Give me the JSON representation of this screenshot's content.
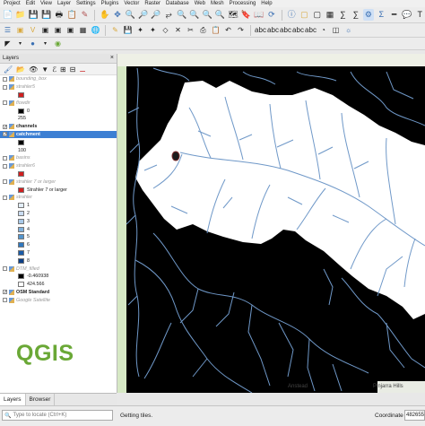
{
  "menu": [
    "Project",
    "Edit",
    "View",
    "Layer",
    "Settings",
    "Plugins",
    "Vector",
    "Raster",
    "Database",
    "Web",
    "Mesh",
    "Processing",
    "Help"
  ],
  "layers_panel": {
    "title": "Layers",
    "close": "×",
    "items": [
      {
        "label": "bounding_box",
        "checked": false,
        "faded": true,
        "bold": false
      },
      {
        "label": "strahler5",
        "checked": false,
        "faded": true,
        "bold": false
      },
      {
        "label": "",
        "swatch": "#d11f1f"
      },
      {
        "label": "flowdir",
        "checked": false,
        "faded": true,
        "bold": false
      },
      {
        "label": "0",
        "swatch": "#000000"
      },
      {
        "label": "255"
      },
      {
        "label": "channels",
        "checked": true,
        "faded": false,
        "bold": true
      },
      {
        "label": "catchment",
        "checked": true,
        "faded": false,
        "bold": true,
        "selected": true
      },
      {
        "label": "",
        "swatch": "#000000"
      },
      {
        "label": "100"
      },
      {
        "label": "basins",
        "checked": false,
        "faded": true,
        "bold": false
      },
      {
        "label": "strahler6",
        "checked": false,
        "faded": true,
        "bold": false
      },
      {
        "label": "",
        "swatch": "#d11f1f"
      },
      {
        "label": "strahler 7 or larger",
        "checked": false,
        "faded": true,
        "bold": false
      },
      {
        "label": "Strahler 7 or larger",
        "swatch": "#d11f1f"
      },
      {
        "label": "strahler",
        "checked": false,
        "faded": true,
        "bold": false
      },
      {
        "label": "1",
        "swatch": "#e3eef9"
      },
      {
        "label": "2",
        "swatch": "#cadcf1"
      },
      {
        "label": "3",
        "swatch": "#a9c9e8"
      },
      {
        "label": "4",
        "swatch": "#7fb0dc"
      },
      {
        "label": "5",
        "swatch": "#5294cd"
      },
      {
        "label": "6",
        "swatch": "#2f78bf"
      },
      {
        "label": "7",
        "swatch": "#1a5ca8"
      },
      {
        "label": "8",
        "swatch": "#0d3f85"
      },
      {
        "label": "DTM_filled",
        "checked": false,
        "faded": true,
        "bold": false
      },
      {
        "label": "-0.460938",
        "swatch": "#000000"
      },
      {
        "label": "424.566",
        "swatch": "#ffffff"
      },
      {
        "label": "OSM Standard",
        "checked": true,
        "faded": false,
        "bold": true
      },
      {
        "label": "Google Satellite",
        "checked": false,
        "faded": true,
        "bold": false
      }
    ]
  },
  "logo": "QGIS",
  "panel_tabs": [
    "Layers",
    "Browser"
  ],
  "map": {
    "labels": [
      "Anstead",
      "Pinjarra Hills"
    ]
  },
  "status": {
    "locator_placeholder": "Type to locate (Ctrl+K)",
    "message": "Getting tiles.",
    "coordinate_label": "Coordinate",
    "coordinate_value": "482655"
  },
  "colors": {
    "accent": "#3c7fd3",
    "stream": "#6f98c8",
    "catchment": "#ffffff",
    "mask": "#000000",
    "logo": "#6aa836"
  }
}
